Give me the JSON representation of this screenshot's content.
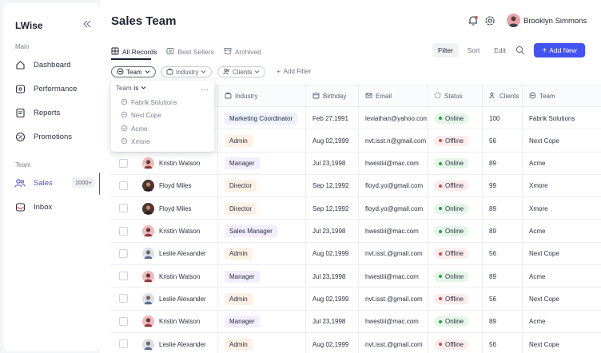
{
  "app": {
    "name": "LWise"
  },
  "sidebar": {
    "main_title": "Main",
    "main_items": [
      {
        "label": "Dashboard",
        "icon": "home-icon"
      },
      {
        "label": "Performance",
        "icon": "performance-icon"
      },
      {
        "label": "Reports",
        "icon": "reports-icon"
      },
      {
        "label": "Promotions",
        "icon": "promotions-icon"
      }
    ],
    "team_title": "Team",
    "team_items": [
      {
        "label": "Sales",
        "badge": "1000+",
        "icon": "users-icon",
        "active": true
      },
      {
        "label": "Inbox",
        "icon": "inbox-icon"
      }
    ]
  },
  "header": {
    "title": "Sales Team",
    "user_name": "Brooklyn Simmons"
  },
  "tabs": [
    {
      "label": "All Records",
      "icon": "grid-icon",
      "active": true
    },
    {
      "label": "Best Sellers",
      "icon": "star-icon"
    },
    {
      "label": "Archived",
      "icon": "archive-icon"
    }
  ],
  "toolbar": {
    "filter": "Filter",
    "sort": "Sort",
    "edit": "Edit",
    "add": "Add New"
  },
  "chips": [
    {
      "label": "Team",
      "icon": "team-icon",
      "active": true
    },
    {
      "label": "Industry",
      "icon": "briefcase-icon"
    },
    {
      "label": "Clients",
      "icon": "clients-icon"
    }
  ],
  "add_filter": "Add Filter",
  "dropdown": {
    "field": "Team",
    "operator": "is",
    "more": "...",
    "options": [
      "Fabrik Solutions",
      "Next Cope",
      "Acme",
      "Xmore"
    ]
  },
  "columns": {
    "industry": "Industry",
    "birthday": "Birthday",
    "email": "Email",
    "status": "Status",
    "clients": "Clients",
    "team": "Team"
  },
  "rows": [
    {
      "name": "",
      "role": "Marketing Coordinator",
      "role_kind": "blue",
      "birthday": "Feb 27,1991",
      "email": "leviathan@yahoo.com",
      "status": "Online",
      "clients": "100",
      "team": "Fabrik Solutions",
      "avatar": ""
    },
    {
      "name": "",
      "role": "Admin",
      "role_kind": "orange",
      "birthday": "Aug 02,1999",
      "email": "nvt.isst.n@gmail.com",
      "status": "Offline",
      "clients": "56",
      "team": "Next Cope",
      "avatar": ""
    },
    {
      "name": "Kristin Watson",
      "role": "Manager",
      "role_kind": "purple",
      "birthday": "Jul 23,1998",
      "email": "hwestiii@mac.com",
      "status": "Online",
      "clients": "89",
      "team": "Acme",
      "avatar": "pink"
    },
    {
      "name": "Floyd Miles",
      "role": "Director",
      "role_kind": "orange",
      "birthday": "Sep 12,1992",
      "email": "floyd.yo@gmail.com",
      "status": "Offline",
      "clients": "99",
      "team": "Xmore",
      "avatar": "dark"
    },
    {
      "name": "Floyd Miles",
      "role": "Director",
      "role_kind": "orange",
      "birthday": "Sep 12,1992",
      "email": "floyd.yo@gmail.com",
      "status": "Online",
      "clients": "89",
      "team": "Xmore",
      "avatar": "dark"
    },
    {
      "name": "Kristin Watson",
      "role": "Sales Manager",
      "role_kind": "purple",
      "birthday": "Jul 23,1998",
      "email": "hwestiii@mac.com",
      "status": "Online",
      "clients": "89",
      "team": "Acme",
      "avatar": "pink"
    },
    {
      "name": "Leslie Alexander",
      "role": "Admin",
      "role_kind": "orange",
      "birthday": "Aug 02,1999",
      "email": "nvt.isst.@gmail.com",
      "status": "Offline",
      "clients": "56",
      "team": "Next Cope",
      "avatar": "light"
    },
    {
      "name": "Kristin Watson",
      "role": "Manager",
      "role_kind": "purple",
      "birthday": "Jul 23,1998",
      "email": "hwestiii@mac.com",
      "status": "Online",
      "clients": "89",
      "team": "Acme",
      "avatar": "pink"
    },
    {
      "name": "Leslie Alexander",
      "role": "Admin",
      "role_kind": "orange",
      "birthday": "Aug 02,1999",
      "email": "nvt.isst.@gmail.com",
      "status": "Offline",
      "clients": "56",
      "team": "Next Cope",
      "avatar": "light"
    },
    {
      "name": "Kristin Watson",
      "role": "Manager",
      "role_kind": "purple",
      "birthday": "Jul 23,1998",
      "email": "hwestiii@mac.com",
      "status": "Online",
      "clients": "89",
      "team": "Acme",
      "avatar": "pink"
    },
    {
      "name": "Leslie Alexander",
      "role": "Admin",
      "role_kind": "orange",
      "birthday": "Aug 02,1999",
      "email": "nvt.isst.@gmail.com",
      "status": "Offline",
      "clients": "56",
      "team": "Next Cope",
      "avatar": "light"
    }
  ],
  "colors": {
    "accent": "#4353f2",
    "online_bg": "#e4f6e7",
    "online_dot": "#22a447",
    "offline_bg": "#fdecec",
    "offline_dot": "#e04545",
    "role_blue_bg": "#eef1fe",
    "role_orange_bg": "#fdf1e5",
    "role_purple_bg": "#f3eefd"
  }
}
